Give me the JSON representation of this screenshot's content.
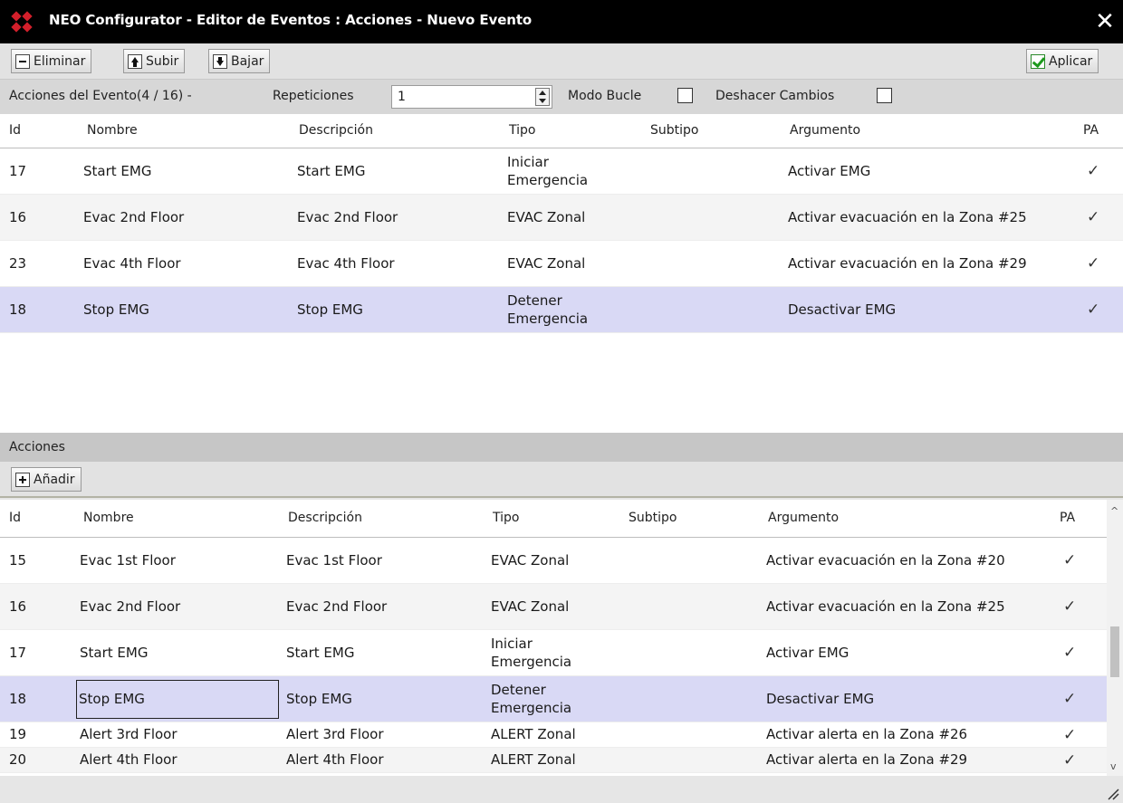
{
  "window": {
    "title": "NEO Configurator - Editor de Eventos : Acciones - Nuevo Evento"
  },
  "toolbar": {
    "eliminar": "Eliminar",
    "subir": "Subir",
    "bajar": "Bajar",
    "aplicar": "Aplicar"
  },
  "options": {
    "acciones_label": "Acciones del Evento(4 / 16) -",
    "repeticiones_label": "Repeticiones",
    "repeticiones_value": "1",
    "modo_bucle_label": "Modo Bucle",
    "modo_bucle_checked": false,
    "deshacer_label": "Deshacer Cambios",
    "deshacer_checked": false
  },
  "columns": [
    "Id",
    "Nombre",
    "Descripción",
    "Tipo",
    "Subtipo",
    "Argumento",
    "PA"
  ],
  "event_actions": [
    {
      "id": "17",
      "nombre": "Start EMG",
      "descripcion": "Start EMG",
      "tipo": "Iniciar Emergencia",
      "subtipo": "",
      "argumento": "Activar EMG",
      "pa": "✓"
    },
    {
      "id": "16",
      "nombre": "Evac 2nd Floor",
      "descripcion": "Evac 2nd Floor",
      "tipo": "EVAC Zonal",
      "subtipo": "",
      "argumento": "Activar evacuación en la Zona #25",
      "pa": "✓"
    },
    {
      "id": "23",
      "nombre": "Evac 4th Floor",
      "descripcion": "Evac 4th Floor",
      "tipo": "EVAC Zonal",
      "subtipo": "",
      "argumento": "Activar evacuación en la Zona #29",
      "pa": "✓"
    },
    {
      "id": "18",
      "nombre": "Stop EMG",
      "descripcion": "Stop EMG",
      "tipo": "Detener Emergencia",
      "subtipo": "",
      "argumento": "Desactivar EMG",
      "pa": "✓"
    }
  ],
  "acciones_section": {
    "label": "Acciones",
    "add_label": "Añadir"
  },
  "all_actions": [
    {
      "id": "15",
      "nombre": "Evac 1st Floor",
      "descripcion": "Evac 1st Floor",
      "tipo": "EVAC Zonal",
      "subtipo": "",
      "argumento": "Activar evacuación en la Zona #20",
      "pa": "✓"
    },
    {
      "id": "16",
      "nombre": "Evac 2nd Floor",
      "descripcion": "Evac 2nd Floor",
      "tipo": "EVAC Zonal",
      "subtipo": "",
      "argumento": "Activar evacuación en la Zona #25",
      "pa": "✓"
    },
    {
      "id": "17",
      "nombre": "Start EMG",
      "descripcion": "Start EMG",
      "tipo": "Iniciar Emergencia",
      "subtipo": "",
      "argumento": "Activar EMG",
      "pa": "✓"
    },
    {
      "id": "18",
      "nombre": "Stop EMG",
      "descripcion": "Stop EMG",
      "tipo": "Detener Emergencia",
      "subtipo": "",
      "argumento": "Desactivar EMG",
      "pa": "✓"
    },
    {
      "id": "19",
      "nombre": "Alert 3rd Floor",
      "descripcion": "Alert 3rd Floor",
      "tipo": "ALERT Zonal",
      "subtipo": "",
      "argumento": "Activar alerta en la Zona #26",
      "pa": "✓"
    },
    {
      "id": "20",
      "nombre": "Alert 4th Floor",
      "descripcion": "Alert 4th Floor",
      "tipo": "ALERT Zonal",
      "subtipo": "",
      "argumento": "Activar alerta en la Zona #29",
      "pa": "✓"
    }
  ],
  "colors": {
    "title_bg": "#000000",
    "selected_row": "#d9d9f5",
    "accent_icon": "#d21f2b",
    "apply_check": "#1c9a1c"
  }
}
